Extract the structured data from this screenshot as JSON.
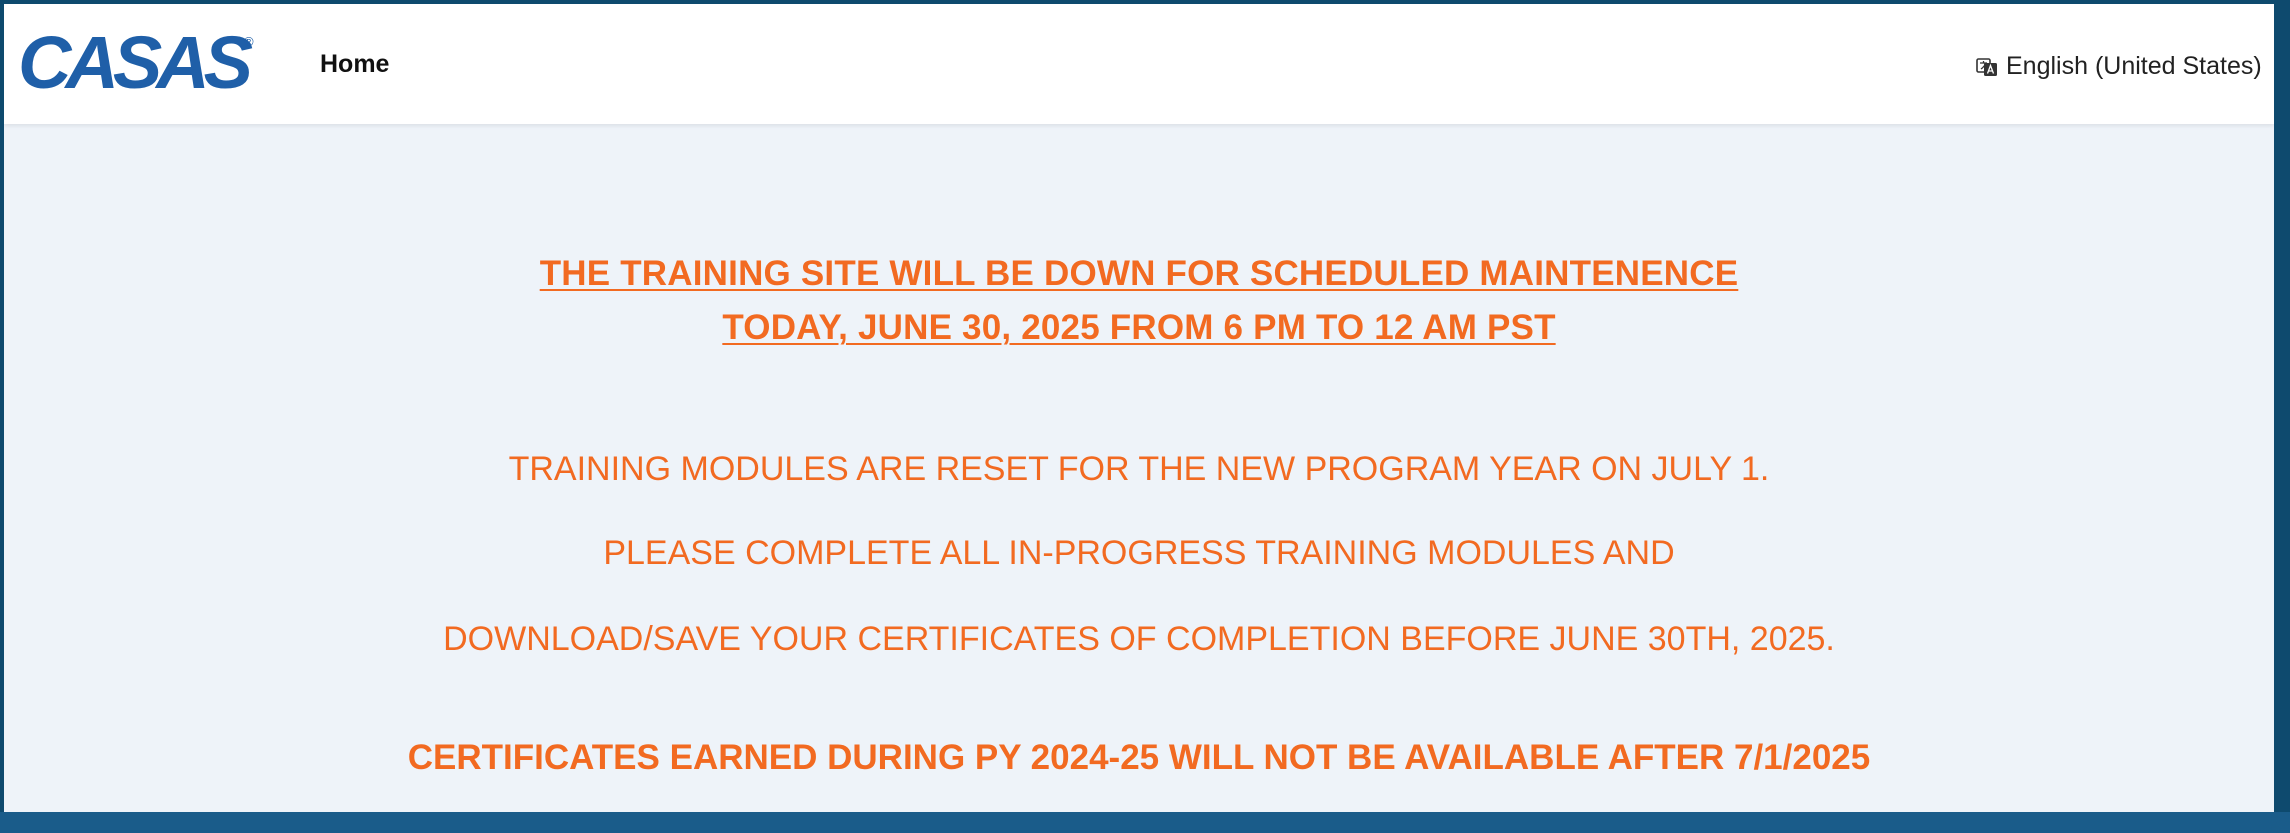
{
  "header": {
    "logo_text": "CASAS",
    "logo_mark": "®",
    "nav_home": "Home",
    "language": "English (United States)",
    "language_icon": "language-icon"
  },
  "notice": {
    "maintenance_line1": "THE TRAINING SITE WILL BE DOWN FOR SCHEDULED MAINTENENCE ",
    "maintenance_line2": "TODAY, JUNE 30, 2025 FROM 6 PM TO 12 AM PST",
    "reset_line1": "TRAINING MODULES ARE RESET FOR THE NEW PROGRAM YEAR ON JULY 1.",
    "reset_line2": "PLEASE COMPLETE ALL IN-PROGRESS TRAINING MODULES AND",
    "reset_line3": "DOWNLOAD/SAVE YOUR CERTIFICATES OF COMPLETION BEFORE JUNE 30TH, 2025.",
    "certificates_line": "CERTIFICATES EARNED DURING PY 2024-25 WILL NOT BE AVAILABLE AFTER 7/1/2025"
  },
  "colors": {
    "accent_orange": "#f26a21",
    "logo_blue": "#1f5fa8",
    "frame_blue": "#0e4a6e",
    "page_bg": "#eef3f9"
  }
}
